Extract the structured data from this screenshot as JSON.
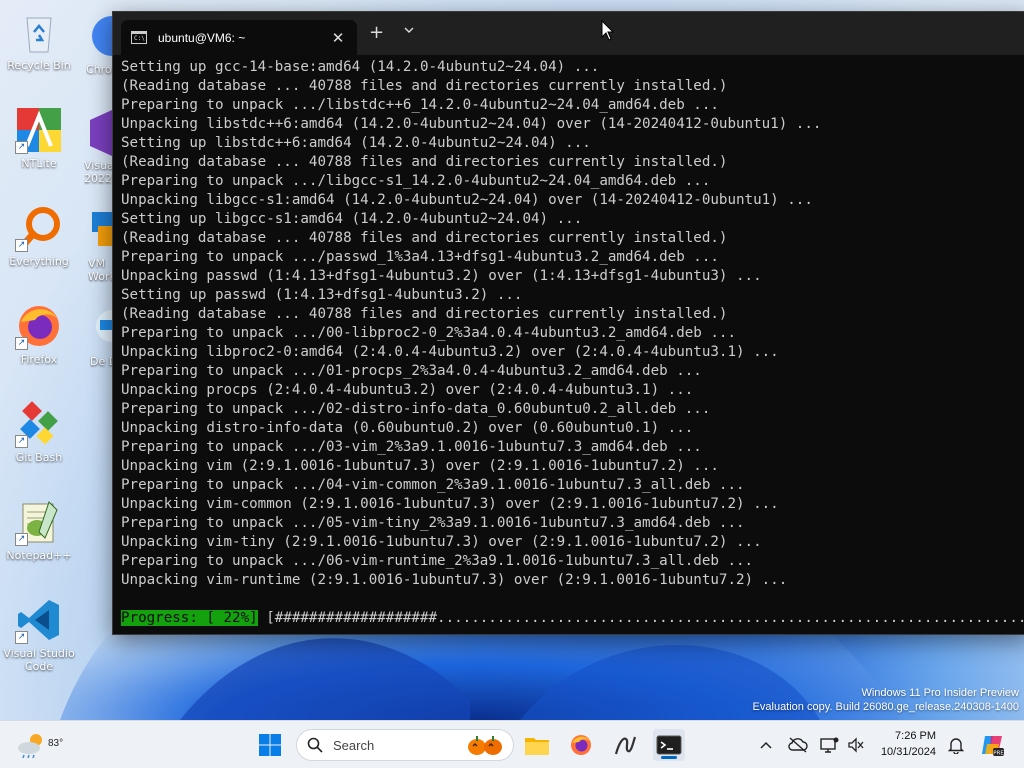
{
  "desktop": {
    "icons": [
      {
        "label": "Recycle Bin"
      },
      {
        "label": "NTLite"
      },
      {
        "label": "Everything"
      },
      {
        "label": "Firefox"
      },
      {
        "label": "Git Bash"
      },
      {
        "label": "Notepad++"
      },
      {
        "label": "Visual Studio Code"
      }
    ],
    "partial_icons": [
      {
        "label": "Chro"
      },
      {
        "label": "Visua 2022"
      },
      {
        "label": "VM Work"
      },
      {
        "label": "De De"
      }
    ],
    "watermark_line1": "Windows 11 Pro Insider Preview",
    "watermark_line2": "Evaluation copy. Build 26080.ge_release.240308-1400"
  },
  "terminal": {
    "tab_title": "ubuntu@VM6: ~",
    "new_tab": "+",
    "dropdown": "⌄",
    "close": "✕",
    "lines": [
      "Setting up gcc-14-base:amd64 (14.2.0-4ubuntu2~24.04) ...",
      "(Reading database ... 40788 files and directories currently installed.)",
      "Preparing to unpack .../libstdc++6_14.2.0-4ubuntu2~24.04_amd64.deb ...",
      "Unpacking libstdc++6:amd64 (14.2.0-4ubuntu2~24.04) over (14-20240412-0ubuntu1) ...",
      "Setting up libstdc++6:amd64 (14.2.0-4ubuntu2~24.04) ...",
      "(Reading database ... 40788 files and directories currently installed.)",
      "Preparing to unpack .../libgcc-s1_14.2.0-4ubuntu2~24.04_amd64.deb ...",
      "Unpacking libgcc-s1:amd64 (14.2.0-4ubuntu2~24.04) over (14-20240412-0ubuntu1) ...",
      "Setting up libgcc-s1:amd64 (14.2.0-4ubuntu2~24.04) ...",
      "(Reading database ... 40788 files and directories currently installed.)",
      "Preparing to unpack .../passwd_1%3a4.13+dfsg1-4ubuntu3.2_amd64.deb ...",
      "Unpacking passwd (1:4.13+dfsg1-4ubuntu3.2) over (1:4.13+dfsg1-4ubuntu3) ...",
      "Setting up passwd (1:4.13+dfsg1-4ubuntu3.2) ...",
      "(Reading database ... 40788 files and directories currently installed.)",
      "Preparing to unpack .../00-libproc2-0_2%3a4.0.4-4ubuntu3.2_amd64.deb ...",
      "Unpacking libproc2-0:amd64 (2:4.0.4-4ubuntu3.2) over (2:4.0.4-4ubuntu3.1) ...",
      "Preparing to unpack .../01-procps_2%3a4.0.4-4ubuntu3.2_amd64.deb ...",
      "Unpacking procps (2:4.0.4-4ubuntu3.2) over (2:4.0.4-4ubuntu3.1) ...",
      "Preparing to unpack .../02-distro-info-data_0.60ubuntu0.2_all.deb ...",
      "Unpacking distro-info-data (0.60ubuntu0.2) over (0.60ubuntu0.1) ...",
      "Preparing to unpack .../03-vim_2%3a9.1.0016-1ubuntu7.3_amd64.deb ...",
      "Unpacking vim (2:9.1.0016-1ubuntu7.3) over (2:9.1.0016-1ubuntu7.2) ...",
      "Preparing to unpack .../04-vim-common_2%3a9.1.0016-1ubuntu7.3_all.deb ...",
      "Unpacking vim-common (2:9.1.0016-1ubuntu7.3) over (2:9.1.0016-1ubuntu7.2) ...",
      "Preparing to unpack .../05-vim-tiny_2%3a9.1.0016-1ubuntu7.3_amd64.deb ...",
      "Unpacking vim-tiny (2:9.1.0016-1ubuntu7.3) over (2:9.1.0016-1ubuntu7.2) ...",
      "Preparing to unpack .../06-vim-runtime_2%3a9.1.0016-1ubuntu7.3_all.deb ...",
      "Unpacking vim-runtime (2:9.1.0016-1ubuntu7.3) over (2:9.1.0016-1ubuntu7.2) ..."
    ],
    "progress_label": "Progress: [ 22%]",
    "progress_bar": " [###################.........................................................................]",
    "progress_percent": 22
  },
  "taskbar": {
    "weather_temp": "83°",
    "search_placeholder": "Search",
    "time": "7:26 PM",
    "date": "10/31/2024",
    "colors": {
      "accent": "#0067c0",
      "progress_green": "#13a10e",
      "terminal_bg": "#0c0c0c"
    }
  }
}
